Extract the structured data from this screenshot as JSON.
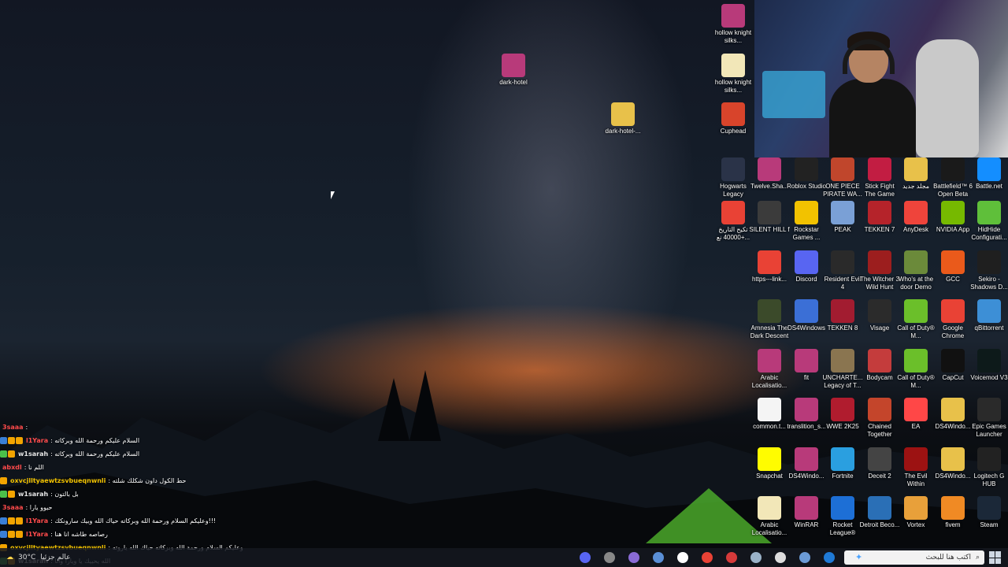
{
  "desktop_top": [
    {
      "label": "dark-hotel",
      "icon": "winrar-icon",
      "color": "#b83a7a"
    },
    {
      "label": "dark-hotel-...",
      "icon": "folder-icon",
      "color": "#e8c14a"
    }
  ],
  "desktop_right_top": [
    {
      "label": "hollow knight silks...",
      "icon": "winrar-icon",
      "color": "#b83a7a"
    },
    {
      "label": "hollow knight silks...",
      "icon": "file-icon",
      "color": "#f2e7b8"
    },
    {
      "label": "Cuphead",
      "icon": "cuphead-icon",
      "color": "#d8442b"
    }
  ],
  "desktop_grid": [
    [
      {
        "label": "Hogwarts Legacy",
        "icon": "hogwarts-icon",
        "color": "#2a3348"
      },
      {
        "label": "Twelve.Sha...",
        "icon": "winrar-icon",
        "color": "#b83a7a"
      },
      {
        "label": "Roblox Studio",
        "icon": "roblox-icon",
        "color": "#222222"
      },
      {
        "label": "ONE PIECE PIRATE WA...",
        "icon": "onepiece-icon",
        "color": "#c0462c"
      },
      {
        "label": "Stick Fight The Game",
        "icon": "stickfight-icon",
        "color": "#c21d42"
      },
      {
        "label": "مجلد جديد",
        "icon": "folder-icon",
        "color": "#e8c14a"
      },
      {
        "label": "Battlefield™ 6 Open Beta",
        "icon": "battlefield-icon",
        "color": "#1a1a1a"
      },
      {
        "label": "Battle.net",
        "icon": "battlenet-icon",
        "color": "#148eff"
      }
    ],
    [
      {
        "label": "تكيح التاريخ +40000 نع...",
        "icon": "chrome-icon",
        "color": "#e94235"
      },
      {
        "label": "SILENT HILL f",
        "icon": "silenthill-icon",
        "color": "#3b3b3b"
      },
      {
        "label": "Rockstar Games ...",
        "icon": "rockstar-icon",
        "color": "#f2c200"
      },
      {
        "label": "PEAK",
        "icon": "peak-icon",
        "color": "#7aa0d6"
      },
      {
        "label": "TEKKEN 7",
        "icon": "tekken7-icon",
        "color": "#b5232a"
      },
      {
        "label": "AnyDesk",
        "icon": "anydesk-icon",
        "color": "#ef443b"
      },
      {
        "label": "NVIDIA App",
        "icon": "nvidia-icon",
        "color": "#76b900"
      },
      {
        "label": "HidHide Configurati...",
        "icon": "hidhide-icon",
        "color": "#5fbf3a"
      }
    ],
    [
      {
        "label": "https---link...",
        "icon": "chrome-icon",
        "color": "#e94235"
      },
      {
        "label": "Discord",
        "icon": "discord-icon",
        "color": "#5865f2"
      },
      {
        "label": "Resident Evil 4",
        "icon": "residentevil-icon",
        "color": "#2a2a2a"
      },
      {
        "label": "The Witcher 3 Wild Hunt",
        "icon": "witcher-icon",
        "color": "#9c1e1e"
      },
      {
        "label": "Who's at the door Demo",
        "icon": "whosatdoor-icon",
        "color": "#6b8a3a"
      },
      {
        "label": "GCC",
        "icon": "gcc-icon",
        "color": "#ea5a1b"
      },
      {
        "label": "Sekiro - Shadows D...",
        "icon": "sekiro-icon",
        "color": "#1f1f1f"
      }
    ],
    [
      {
        "label": "Amnesia The Dark Descent",
        "icon": "amnesia-icon",
        "color": "#3b4a2a"
      },
      {
        "label": "DS4Windows",
        "icon": "gamepad-icon",
        "color": "#3b6fd6"
      },
      {
        "label": "TEKKEN 8",
        "icon": "tekken8-icon",
        "color": "#a21c30"
      },
      {
        "label": "Visage",
        "icon": "visage-icon",
        "color": "#2b2b2b"
      },
      {
        "label": "Call of Duty® M...",
        "icon": "cod-icon",
        "color": "#6bbf2a"
      },
      {
        "label": "Google Chrome",
        "icon": "chrome-icon",
        "color": "#e94235"
      },
      {
        "label": "qBittorrent",
        "icon": "qbittorrent-icon",
        "color": "#3d8fd6"
      }
    ],
    [
      {
        "label": "Arabic Localisatio...",
        "icon": "winrar-icon",
        "color": "#b83a7a"
      },
      {
        "label": "fit",
        "icon": "winrar-icon",
        "color": "#b83a7a"
      },
      {
        "label": "UNCHARTE... Legacy of T...",
        "icon": "uncharted-icon",
        "color": "#8a7550"
      },
      {
        "label": "Bodycam",
        "icon": "bodycam-icon",
        "color": "#c43c3c"
      },
      {
        "label": "Call of Duty® M...",
        "icon": "cod-icon",
        "color": "#6bbf2a"
      },
      {
        "label": "CapCut",
        "icon": "capcut-icon",
        "color": "#111111"
      },
      {
        "label": "Voicemod V3",
        "icon": "voicemod-icon",
        "color": "#0d1a1a"
      }
    ],
    [
      {
        "label": "common.t...",
        "icon": "file-icon",
        "color": "#f4f4f4"
      },
      {
        "label": "translition_s...",
        "icon": "winrar-icon",
        "color": "#b83a7a"
      },
      {
        "label": "WWE 2K25",
        "icon": "wwe-icon",
        "color": "#b01c2e"
      },
      {
        "label": "Chained Together",
        "icon": "chained-icon",
        "color": "#c4452b"
      },
      {
        "label": "EA",
        "icon": "ea-icon",
        "color": "#ff4747"
      },
      {
        "label": "DS4Windo...",
        "icon": "folder-icon",
        "color": "#e8c14a"
      },
      {
        "label": "Epic Games Launcher",
        "icon": "epic-icon",
        "color": "#2a2a2a"
      }
    ],
    [
      {
        "label": "Snapchat",
        "icon": "snapchat-icon",
        "color": "#fffc00"
      },
      {
        "label": "DS4Windo...",
        "icon": "winrar-icon",
        "color": "#b83a7a"
      },
      {
        "label": "Fortnite",
        "icon": "fortnite-icon",
        "color": "#2a9fe0"
      },
      {
        "label": "Deceit 2",
        "icon": "deceit-icon",
        "color": "#444444"
      },
      {
        "label": "The Evil Within",
        "icon": "evilwithin-icon",
        "color": "#9c1212"
      },
      {
        "label": "DS4Windo...",
        "icon": "folder-icon",
        "color": "#e8c14a"
      },
      {
        "label": "Logitech G HUB",
        "icon": "logitech-icon",
        "color": "#222222"
      }
    ],
    [
      {
        "label": "Arabic Localisatio...",
        "icon": "file-icon",
        "color": "#f2e7b8"
      },
      {
        "label": "WinRAR",
        "icon": "winrar-icon",
        "color": "#b83a7a"
      },
      {
        "label": "Rocket League®",
        "icon": "rocketleague-icon",
        "color": "#1d6fd6"
      },
      {
        "label": "Detroit Beco...",
        "icon": "detroit-icon",
        "color": "#2a6fb6"
      },
      {
        "label": "Vortex",
        "icon": "vortex-icon",
        "color": "#e8a03a"
      },
      {
        "label": "fivem",
        "icon": "fivem-icon",
        "color": "#f08a24"
      },
      {
        "label": "Steam",
        "icon": "steam-icon",
        "color": "#1b2838"
      }
    ]
  ],
  "chat": [
    {
      "user": "3saaa",
      "user_color": "#ff4b4b",
      "msg": ":",
      "badges": []
    },
    {
      "user": "l1Yara",
      "user_color": "#ff4b4b",
      "msg": ": السلام عليكم ورحمة الله وبركاته",
      "badges": [
        "#3a7fd6",
        "#f2a400",
        "#f2a400"
      ]
    },
    {
      "user": "w1sarah",
      "user_color": "#e6e6e6",
      "msg": ": السلام عليكم ورحمة الله وبركاته",
      "badges": [
        "#4ac04a",
        "#f2a400"
      ]
    },
    {
      "user": "abxdl",
      "user_color": "#ff4b4b",
      "msg": ": اللم نا",
      "badges": []
    },
    {
      "user": "oxvcjlltyaewtzsvbueqnwnli",
      "user_color": "#f2c200",
      "msg": ": حط الكول داون شكلك شلته",
      "badges": [
        "#f2a400"
      ]
    },
    {
      "user": "w1sarah",
      "user_color": "#e6e6e6",
      "msg": ": بل بالتون",
      "badges": [
        "#4ac04a",
        "#f2a400"
      ]
    },
    {
      "user": "3saaa",
      "user_color": "#ff4b4b",
      "msg": ": حيوو يارا",
      "badges": []
    },
    {
      "user": "l1Yara",
      "user_color": "#ff4b4b",
      "msg": ": وعليكم السلام ورحمة الله وبركاته حياك الله وبيك سارونكك!!!",
      "badges": [
        "#3a7fd6",
        "#f2a400",
        "#f2a400"
      ]
    },
    {
      "user": "l1Yara",
      "user_color": "#ff4b4b",
      "msg": ": رصاصه طاشه انا هنا",
      "badges": [
        "#3a7fd6",
        "#f2a400",
        "#f2a400"
      ]
    },
    {
      "user": "oxvcjlltyaewtzsvbueqnwnli",
      "user_color": "#f2c200",
      "msg": ": وعليكم السلام ورحمة الله وبركاته حياك الله ياروته",
      "badges": [
        "#f2a400"
      ]
    },
    {
      "user": "w1sarah",
      "user_color": "#e6e6e6",
      "msg": ": الله يحييك يا ويارا وأنا",
      "badges": [
        "#4ac04a",
        "#f2a400"
      ]
    }
  ],
  "taskbar": {
    "weather": "30°C",
    "weather_text": "عالم جزئيا",
    "search_placeholder": "اكتب هنا للبحث",
    "apps": [
      {
        "name": "discord-icon",
        "color": "#5865f2"
      },
      {
        "name": "dots-icon",
        "color": "#888888"
      },
      {
        "name": "gamepad-icon",
        "color": "#8a6bd6"
      },
      {
        "name": "calculator-icon",
        "color": "#5a8fd6"
      },
      {
        "name": "store-icon",
        "color": "#ffffff"
      },
      {
        "name": "chrome-icon",
        "color": "#e94235"
      },
      {
        "name": "record-icon",
        "color": "#d63a3a"
      },
      {
        "name": "steam-icon",
        "color": "#9ab2c8"
      },
      {
        "name": "settings-icon",
        "color": "#dddddd"
      },
      {
        "name": "app-icon",
        "color": "#6b9bd6"
      },
      {
        "name": "outlook-icon",
        "color": "#1f7ad6"
      },
      {
        "name": "explorer-icon",
        "color": "#e8c14a"
      },
      {
        "name": "edge-icon",
        "color": "#1fa3c8"
      }
    ]
  }
}
